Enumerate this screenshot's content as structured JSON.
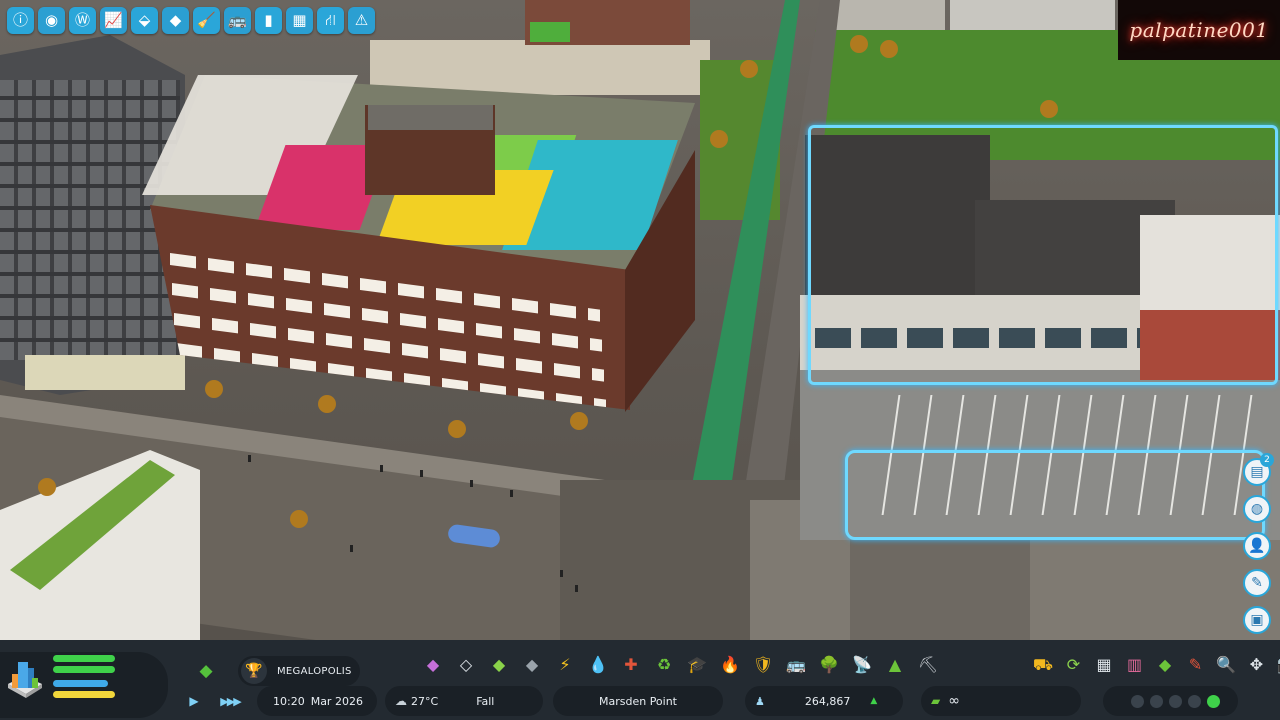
{
  "top_toolbar": {
    "tools": [
      {
        "name": "info-view",
        "glyph": "ⓘ"
      },
      {
        "name": "overview",
        "glyph": "◉"
      },
      {
        "name": "wonders",
        "glyph": "Ⓦ"
      },
      {
        "name": "statistics",
        "glyph": "📈"
      },
      {
        "name": "roads-layer",
        "glyph": "⬙"
      },
      {
        "name": "districts",
        "glyph": "◆"
      },
      {
        "name": "cleaning",
        "glyph": "🧹"
      },
      {
        "name": "vehicles",
        "glyph": "🚌"
      },
      {
        "name": "energy",
        "glyph": "▮"
      },
      {
        "name": "zoning",
        "glyph": "▦"
      },
      {
        "name": "routes",
        "glyph": "⛙"
      },
      {
        "name": "construction",
        "glyph": "⚠"
      }
    ]
  },
  "watermark": {
    "text": "palpatine001"
  },
  "side_panel": {
    "notifications_count": "2",
    "buttons": [
      "chat-icon",
      "globe-icon",
      "citizen-icon",
      "notes-icon",
      "photo-icon"
    ]
  },
  "hud": {
    "milestone": "MEGALOPOLIS",
    "date_time": "10:20",
    "date": "Mar 2026",
    "temperature": "27°C",
    "season": "Fall",
    "city_name": "Marsden Point",
    "population": "264,867",
    "money": "∞",
    "meters": [
      {
        "fraction": 0.62,
        "color": "#3fd14a"
      },
      {
        "fraction": 0.62,
        "color": "#3fd14a"
      },
      {
        "fraction": 0.55,
        "color": "#3fa9e8"
      },
      {
        "fraction": 0.62,
        "color": "#f1d63b"
      }
    ],
    "build_tools": [
      {
        "name": "roads",
        "glyph": "◆",
        "color": "#c66fd9"
      },
      {
        "name": "landscaping",
        "glyph": "◇",
        "color": "#dde3e8"
      },
      {
        "name": "zoning",
        "glyph": "◆",
        "color": "#8ad24a"
      },
      {
        "name": "area",
        "glyph": "◆",
        "color": "#9aa3ab"
      },
      {
        "name": "electricity",
        "glyph": "⚡",
        "color": "#f5c31f"
      },
      {
        "name": "water",
        "glyph": "💧",
        "color": "#3fb6ec"
      },
      {
        "name": "health",
        "glyph": "✚",
        "color": "#e2553b"
      },
      {
        "name": "garbage",
        "glyph": "♻",
        "color": "#6cc43a"
      },
      {
        "name": "education",
        "glyph": "🎓",
        "color": "#b7bfc6"
      },
      {
        "name": "fire",
        "glyph": "🔥",
        "color": "#e8543a"
      },
      {
        "name": "police",
        "glyph": "🛡",
        "color": "#f2b81f"
      },
      {
        "name": "transport",
        "glyph": "🚌",
        "color": "#6cc43a"
      },
      {
        "name": "parks",
        "glyph": "🌳",
        "color": "#8bd24d"
      },
      {
        "name": "communication",
        "glyph": "📡",
        "color": "#c9ced3"
      },
      {
        "name": "landscape",
        "glyph": "▲",
        "color": "#6cc43a"
      },
      {
        "name": "signature",
        "glyph": "⛏",
        "color": "#c9ced3"
      }
    ],
    "right_tools": [
      {
        "name": "bulldoze",
        "glyph": "⛟",
        "color": "#f2b81f"
      },
      {
        "name": "refresh",
        "glyph": "⟳",
        "color": "#8bd24d"
      },
      {
        "name": "map",
        "glyph": "▦",
        "color": "#dde3e8"
      },
      {
        "name": "policies",
        "glyph": "▥",
        "color": "#e26a9a"
      },
      {
        "name": "terrain",
        "glyph": "◆",
        "color": "#6cc43a"
      },
      {
        "name": "brush",
        "glyph": "✎",
        "color": "#e2553b"
      },
      {
        "name": "search",
        "glyph": "🔍",
        "color": "#9fc6e8"
      },
      {
        "name": "move",
        "glyph": "✥",
        "color": "#dde3e8"
      },
      {
        "name": "camera",
        "glyph": "📷",
        "color": "#dde3e8"
      }
    ]
  }
}
